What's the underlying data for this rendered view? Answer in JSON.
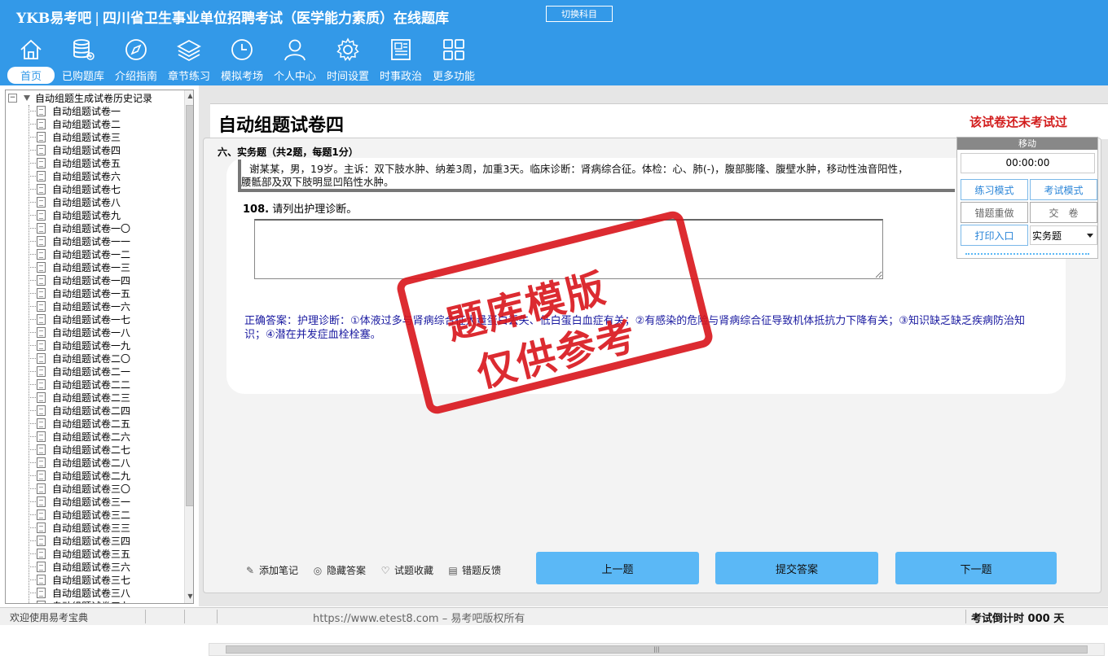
{
  "app": {
    "brand": "YKB易考吧",
    "title": "四川省卫生事业单位招聘考试（医学能力素质）在线题库",
    "switch_label": "切换科目"
  },
  "nav": [
    {
      "label": "首页",
      "icon": "home-icon"
    },
    {
      "label": "已购题库",
      "icon": "database-icon"
    },
    {
      "label": "介绍指南",
      "icon": "compass-icon"
    },
    {
      "label": "章节练习",
      "icon": "layers-icon"
    },
    {
      "label": "模拟考场",
      "icon": "clock-icon"
    },
    {
      "label": "个人中心",
      "icon": "user-icon"
    },
    {
      "label": "时间设置",
      "icon": "gear-icon"
    },
    {
      "label": "时事政治",
      "icon": "news-icon"
    },
    {
      "label": "更多功能",
      "icon": "grid-icon"
    }
  ],
  "tree": {
    "root": "自动组题生成试卷历史记录",
    "items": [
      "自动组题试卷一",
      "自动组题试卷二",
      "自动组题试卷三",
      "自动组题试卷四",
      "自动组题试卷五",
      "自动组题试卷六",
      "自动组题试卷七",
      "自动组题试卷八",
      "自动组题试卷九",
      "自动组题试卷一〇",
      "自动组题试卷一一",
      "自动组题试卷一二",
      "自动组题试卷一三",
      "自动组题试卷一四",
      "自动组题试卷一五",
      "自动组题试卷一六",
      "自动组题试卷一七",
      "自动组题试卷一八",
      "自动组题试卷一九",
      "自动组题试卷二〇",
      "自动组题试卷二一",
      "自动组题试卷二二",
      "自动组题试卷二三",
      "自动组题试卷二四",
      "自动组题试卷二五",
      "自动组题试卷二六",
      "自动组题试卷二七",
      "自动组题试卷二八",
      "自动组题试卷二九",
      "自动组题试卷三〇",
      "自动组题试卷三一",
      "自动组题试卷三二",
      "自动组题试卷三三",
      "自动组题试卷三四",
      "自动组题试卷三五",
      "自动组题试卷三六",
      "自动组题试卷三七",
      "自动组题试卷三八",
      "自动组题试卷三九"
    ]
  },
  "paper": {
    "title": "自动组题试卷四",
    "status": "该试卷还未考试过",
    "section": "六、实务题（共2题，每题1分）",
    "stem_line1": "谢某某，男，19岁。主诉：双下肢水肿、纳差3周，加重3天。临床诊断：肾病综合征。体检：心、肺(-)，腹部膨隆、腹壁水肿，移动性浊音阳性，",
    "stem_line2": "腰骶部及双下肢明显凹陷性水肿。",
    "q_number": "108.",
    "q_text": "请列出护理诊断。",
    "answer_value": "",
    "correct_answer": "正确答案：护理诊断：①体液过多与肾病综合征大量蛋白丢失、低白蛋白血症有关；②有感染的危险与肾病综合征导致机体抵抗力下降有关；③知识缺乏缺乏疾病防治知识；④潜在并发症血栓栓塞。"
  },
  "tools": {
    "add_note": "添加笔记",
    "hide_answer": "隐藏答案",
    "favorite": "试题收藏",
    "report": "错题反馈"
  },
  "buttons": {
    "prev": "上一题",
    "submit": "提交答案",
    "next": "下一题"
  },
  "panel": {
    "header": "移动",
    "timer": "00:00:00",
    "practice_mode": "练习模式",
    "exam_mode": "考试模式",
    "redo_wrong": "错题重做",
    "hand_in": "交　卷",
    "print": "打印入口",
    "type_selected": "实务题"
  },
  "watermark": {
    "line1": "题库模版",
    "line2": "仅供参考"
  },
  "statusbar": {
    "welcome": "欢迎使用易考宝典",
    "copyright": "https://www.etest8.com – 易考吧版权所有",
    "countdown": "考试倒计时 000 天"
  },
  "colors": {
    "header_bg": "#3399e8",
    "button_blue": "#5bb8f6",
    "status_red": "#d21d1d",
    "answer_text": "#1a1aa0",
    "stamp_red": "#d9151b"
  }
}
